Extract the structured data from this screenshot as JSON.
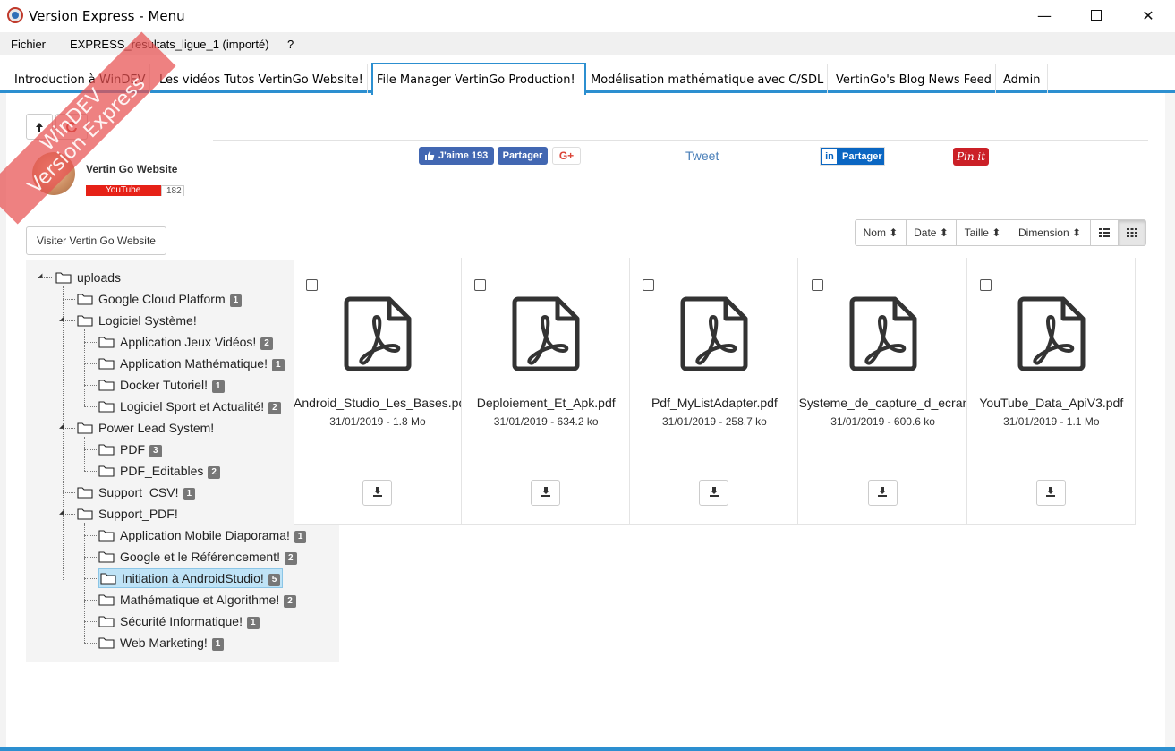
{
  "window": {
    "title": "Version Express - Menu",
    "min_label": "—",
    "close_label": "✕"
  },
  "menubar": {
    "items": [
      "Fichier",
      "EXPRESS_resultats_ligue_1 (importé)",
      "?"
    ]
  },
  "tabs": [
    {
      "label": "Introduction à WinDEV",
      "active": false
    },
    {
      "label": "Les vidéos Tutos VertinGo Website!",
      "active": false
    },
    {
      "label": "File Manager VertinGo Production!",
      "active": true
    },
    {
      "label": "Modélisation mathématique avec C/SDL",
      "active": false
    },
    {
      "label": "VertinGo's Blog News Feed",
      "active": false
    },
    {
      "label": "Admin",
      "active": false
    }
  ],
  "watermark": {
    "line1": "WinDEV",
    "line2": "Version Express"
  },
  "toolbar": {
    "up_icon": "arrow-up-icon",
    "refresh_icon": "refresh-icon"
  },
  "channel": {
    "name": "Vertin Go Website",
    "youtube_label": "YouTube",
    "subscriber_count": "182"
  },
  "social": {
    "fb_like_label": "J'aime 193",
    "fb_share_label": "Partager",
    "gplus_label": "G+",
    "tweet_label": "Tweet",
    "linkedin_label": "Partager",
    "pinterest_label": "Pin it"
  },
  "visit_button": "Visiter Vertin Go Website",
  "sort": {
    "buttons": [
      "Nom ⬍",
      "Date ⬍",
      "Taille ⬍",
      "Dimension ⬍"
    ],
    "list_view_icon": "list-view-icon",
    "grid_view_icon": "grid-view-icon",
    "active_view": "grid"
  },
  "tree": {
    "root": "uploads",
    "nodes": [
      {
        "label": "Google Cloud Platform",
        "badge": "1"
      },
      {
        "label": "Logiciel Système!",
        "badge": ""
      },
      {
        "label": "Application Jeux Vidéos!",
        "badge": "2"
      },
      {
        "label": "Application Mathématique!",
        "badge": "1"
      },
      {
        "label": "Docker Tutoriel!",
        "badge": "1"
      },
      {
        "label": "Logiciel Sport et Actualité!",
        "badge": "2"
      },
      {
        "label": "Power Lead System!",
        "badge": ""
      },
      {
        "label": "PDF",
        "badge": "3"
      },
      {
        "label": "PDF_Editables",
        "badge": "2"
      },
      {
        "label": "Support_CSV!",
        "badge": "1"
      },
      {
        "label": "Support_PDF!",
        "badge": ""
      },
      {
        "label": "Application Mobile Diaporama!",
        "badge": "1"
      },
      {
        "label": "Google et le Référencement!",
        "badge": "2"
      },
      {
        "label": "Initiation à AndroidStudio!",
        "badge": "5",
        "selected": true
      },
      {
        "label": "Mathématique et Algorithme!",
        "badge": "2"
      },
      {
        "label": "Sécurité Informatique!",
        "badge": "1"
      },
      {
        "label": "Web Marketing!",
        "badge": "1"
      }
    ]
  },
  "files": [
    {
      "name": "Android_Studio_Les_Bases.pdf",
      "meta": "31/01/2019 - 1.8 Mo",
      "icon": "pdf-file-icon"
    },
    {
      "name": "Deploiement_Et_Apk.pdf",
      "meta": "31/01/2019 - 634.2 ko",
      "icon": "pdf-file-icon"
    },
    {
      "name": "Pdf_MyListAdapter.pdf",
      "meta": "31/01/2019 - 258.7 ko",
      "icon": "pdf-file-icon"
    },
    {
      "name": "Systeme_de_capture_d_ecran.pdf",
      "meta": "31/01/2019 - 600.6 ko",
      "icon": "pdf-file-icon"
    },
    {
      "name": "YouTube_Data_ApiV3.pdf",
      "meta": "31/01/2019 - 1.1 Mo",
      "icon": "pdf-file-icon"
    }
  ]
}
